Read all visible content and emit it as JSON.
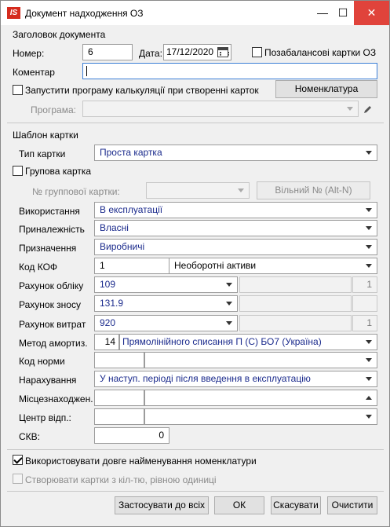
{
  "window": {
    "title": "Документ надходження  ОЗ",
    "app_icon_text": "IS",
    "minimize_label": "—",
    "maximize_label": "☐",
    "close_label": "✕"
  },
  "header_section": {
    "title": "Заголовок документа",
    "number_label": "Номер:",
    "number_value": "6",
    "date_label": "Дата:",
    "date_value": "17/12/2020",
    "offbalance_label": "Позабалансові картки ОЗ",
    "comment_label": "Коментар",
    "comment_value": "",
    "run_calc_label": "Запустити програму калькуляції при створенні карток",
    "nomenclature_button": "Номенклатура",
    "program_label": "Програма:",
    "program_value": ""
  },
  "template_section": {
    "title": "Шаблон картки",
    "card_type_label": "Тип картки",
    "card_type_value": "Проста картка",
    "group_card_label": "Групова картка",
    "group_number_label": "№ группової картки:",
    "group_number_value": "",
    "free_number_button": "Вільний № (Alt-N)",
    "usage_label": "Використання",
    "usage_value": "В експлуатації",
    "ownership_label": "Приналежність",
    "ownership_value": "Власні",
    "purpose_label": "Призначення",
    "purpose_value": "Виробничі",
    "kof_label": "Код КОФ",
    "kof_code": "1",
    "kof_value": "Необоротні активи",
    "account_label": "Рахунок обліку",
    "account_value": "109",
    "account_qty": "1",
    "depr_account_label": "Рахунок зносу",
    "depr_account_value": "131.9",
    "expense_account_label": "Рахунок витрат",
    "expense_account_value": "920",
    "expense_qty": "1",
    "depr_method_label": "Метод амортиз.",
    "depr_method_code": "14",
    "depr_method_value": "Прямолінійного списання П (С) БО7 (Україна)",
    "norm_code_label": "Код норми",
    "norm_code_value": "",
    "accrual_label": "Нарахування",
    "accrual_value": "У наступ. періоді після введення в експлуатацію",
    "location_label": "Місцезнаходжен.",
    "responsibility_label": "Центр відп.:",
    "skv_label": "СКВ:",
    "skv_value": "0"
  },
  "options": {
    "long_name_label": "Використовувати довге найменування номенклатури",
    "qty_one_label": "Створювати картки з кіл-тю, рівною одиниці"
  },
  "footer": {
    "apply_all": "Застосувати до всіх",
    "ok": "ОК",
    "cancel": "Скасувати",
    "clear": "Очистити"
  }
}
